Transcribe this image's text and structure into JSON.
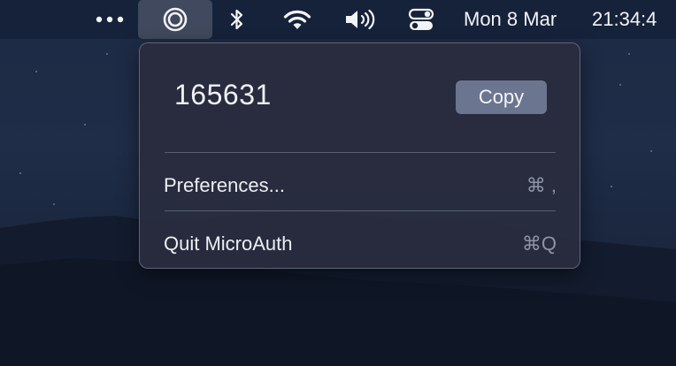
{
  "menubar": {
    "items": [
      {
        "name": "overflow-menu",
        "icon": "ellipsis-icon"
      },
      {
        "name": "microauth-status-item",
        "icon": "microauth-ring-icon",
        "active": true
      },
      {
        "name": "bluetooth-status-item",
        "icon": "bluetooth-icon"
      },
      {
        "name": "wifi-status-item",
        "icon": "wifi-icon"
      },
      {
        "name": "volume-status-item",
        "icon": "speaker-volume-icon"
      },
      {
        "name": "control-center-item",
        "icon": "control-center-toggle-icon"
      }
    ],
    "date": "Mon 8 Mar",
    "time": "21:34:4"
  },
  "popup": {
    "code": "165631",
    "copy_label": "Copy",
    "menu": [
      {
        "label": "Preferences...",
        "shortcut": "⌘ ,"
      },
      {
        "label": "Quit MicroAuth",
        "shortcut": "⌘Q"
      }
    ]
  },
  "colors": {
    "menubar_bg": "#16223a",
    "popup_bg": "#282c3e",
    "copy_button_bg": "#6b7590",
    "shortcut_text": "#8d93a6",
    "desktop_sky": "#1f2d48",
    "mountains": "#121b2c"
  }
}
